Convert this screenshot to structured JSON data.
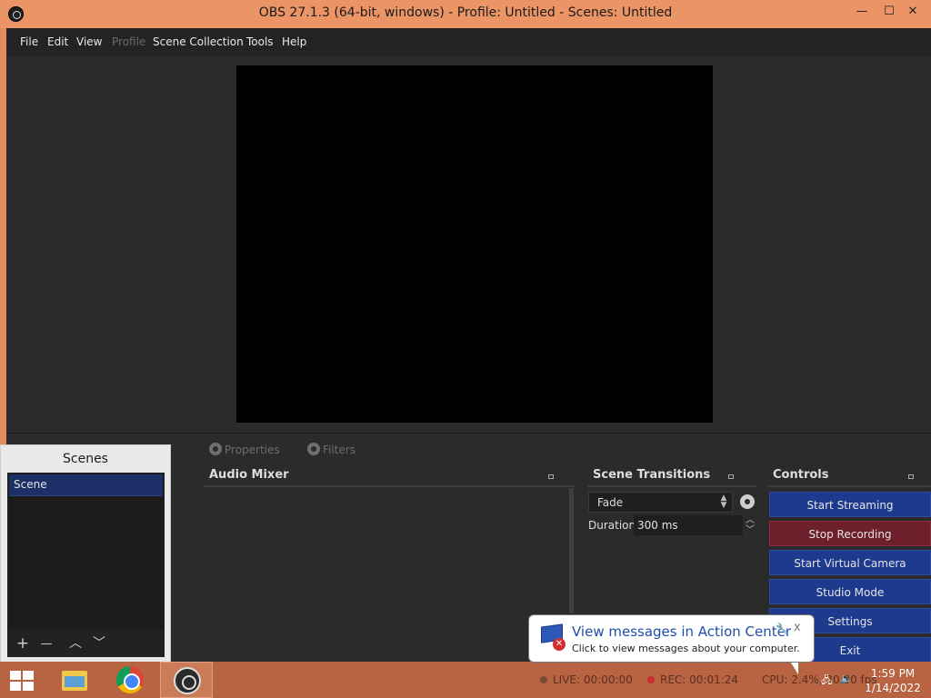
{
  "window": {
    "title": "OBS 27.1.3 (64-bit, windows) - Profile: Untitled - Scenes: Untitled",
    "min_glyph": "—",
    "max_glyph": "☐",
    "close_glyph": "✕"
  },
  "menu": [
    {
      "label": "File"
    },
    {
      "label": "Edit"
    },
    {
      "label": "View"
    },
    {
      "label": "Profile",
      "disabled": true
    },
    {
      "label": "Scene Collection"
    },
    {
      "label": "Tools"
    },
    {
      "label": "Help"
    }
  ],
  "source_toolbar": {
    "properties": "Properties",
    "filters": "Filters"
  },
  "docks": {
    "audio_mixer": "Audio Mixer",
    "scene_transitions": "Scene Transitions",
    "controls": "Controls"
  },
  "transitions": {
    "selected": "Fade",
    "duration_label": "Duration",
    "duration_value": "300 ms"
  },
  "controls": [
    {
      "label": "Start Streaming"
    },
    {
      "label": "Stop Recording",
      "state": "recording"
    },
    {
      "label": "Start Virtual Camera"
    },
    {
      "label": "Studio Mode"
    },
    {
      "label": "Settings"
    },
    {
      "label": "Exit"
    }
  ],
  "scenes": {
    "title": "Scenes",
    "items": [
      "Scene"
    ],
    "tool_add": "+",
    "tool_remove": "—",
    "tool_up": "︿",
    "tool_down": "﹀"
  },
  "status": {
    "live": "LIVE: 00:00:00",
    "rec": "REC: 00:01:24",
    "cpu": "CPU: 2.4%, 30.00 fps"
  },
  "taskbar": {
    "time": "1:59 PM",
    "date": "1/14/2022"
  },
  "notification": {
    "title": "View messages in Action Center",
    "text": "Click to view messages about your computer.",
    "close": "x"
  },
  "colors": {
    "accent_frame": "#eb9465",
    "control_button": "#1d3a8f",
    "recording_button": "#6e1f2c",
    "selected_scene": "#1c2f66"
  }
}
